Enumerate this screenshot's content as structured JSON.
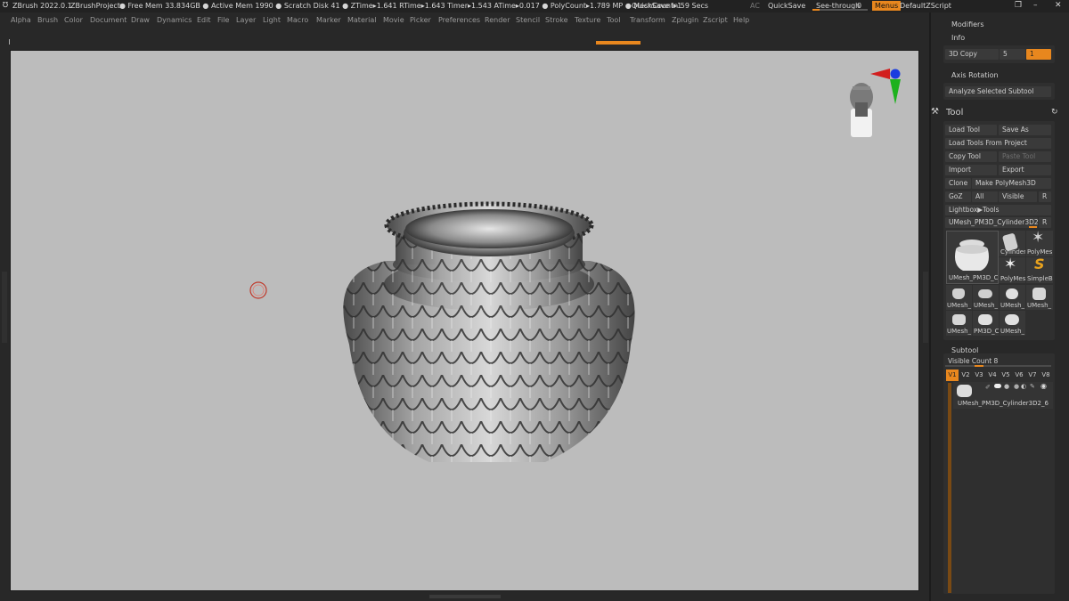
{
  "titlebar": {
    "app": "ZBrush 2022.0.1",
    "project": "ZBrushProject",
    "stats": "● Free Mem 33.834GB ● Active Mem 1990 ● Scratch Disk 41 ● ZTime▸1.641 RTime▸1.643 Timer▸1.543 ATime▸0.017 ● PolyCount▸1.789 MP ● MeshCount▸1",
    "quicksave_timer": "▸QuickSave In 59 Secs",
    "ac": "AC",
    "quicksave": "QuickSave",
    "see_through": "See-through",
    "see_through_value": "0",
    "menus": "Menus",
    "default_zscript": "DefaultZScript"
  },
  "menubar": [
    "Alpha",
    "Brush",
    "Color",
    "Document",
    "Draw",
    "Dynamics",
    "Edit",
    "File",
    "Layer",
    "Light",
    "Macro",
    "Marker",
    "Material",
    "Movie",
    "Picker",
    "Preferences",
    "Render",
    "Stencil",
    "Stroke",
    "Texture",
    "Tool",
    "Transform",
    "Zplugin",
    "Zscript",
    "Help"
  ],
  "right": {
    "modifiers": "Modifiers",
    "info": "Info",
    "copy3d": "3D Copy",
    "copy3d_value": "5",
    "copy3d_field": "1",
    "axis_rotation": "Axis Rotation",
    "analyze": "Analyze Selected Subtool",
    "tool_title": "Tool",
    "load_tool": "Load Tool",
    "save_as": "Save As",
    "load_from_project": "Load Tools From Project",
    "copy_tool": "Copy Tool",
    "paste_tool": "Paste Tool",
    "import": "Import",
    "export": "Export",
    "clone": "Clone",
    "make_polymesh": "Make PolyMesh3D",
    "goz": "GoZ",
    "all": "All",
    "visible": "Visible",
    "r": "R",
    "lightbox_tools": "Lightbox▶Tools",
    "current_tool": "UMesh_PM3D_Cylinder3D2_6",
    "current_tool_r": "R",
    "thumbs": {
      "main": "UMesh_PM3D_C",
      "cylinder": "Cylinder",
      "polymesh1": "PolyMes",
      "polymesh2": "PolyMes",
      "simpleb": "SimpleB",
      "row3": [
        "UMesh_",
        "UMesh_",
        "UMesh_",
        "UMesh_"
      ],
      "row4": [
        "UMesh_",
        "PM3D_C",
        "UMesh_"
      ]
    },
    "subtool": "Subtool",
    "visible_count": "Visible Count 8",
    "vtabs": [
      "V1",
      "V2",
      "V3",
      "V4",
      "V5",
      "V6",
      "V7",
      "V8"
    ],
    "subtool_item": "UMesh_PM3D_Cylinder3D2_6"
  },
  "colors": {
    "accent": "#e8871e",
    "viewport": "#bcbcbc",
    "panel": "#282828"
  }
}
